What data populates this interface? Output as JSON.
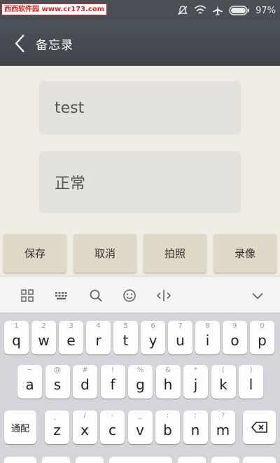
{
  "status_bar": {
    "watermark": "西西软件园 www.cr173.com",
    "battery": "97%",
    "icons": [
      "mute-icon",
      "wifi-icon",
      "airplane-icon",
      "battery-icon"
    ]
  },
  "action_bar": {
    "back_icon": "chevron-left-icon",
    "title": "备忘录"
  },
  "note": {
    "title_value": "test",
    "body_value": "正常"
  },
  "buttons": {
    "save": "保存",
    "cancel": "取消",
    "photo": "拍照",
    "video": "录像"
  },
  "keyboard_toolbar": {
    "icons": [
      "grid-icon",
      "keyboard-icon",
      "search-icon",
      "emoji-icon",
      "cursor-icon",
      "collapse-icon"
    ]
  },
  "keyboard": {
    "row1": [
      {
        "main": "q",
        "sub": "1"
      },
      {
        "main": "w",
        "sub": "2"
      },
      {
        "main": "e",
        "sub": "3"
      },
      {
        "main": "r",
        "sub": "4"
      },
      {
        "main": "t",
        "sub": "5"
      },
      {
        "main": "y",
        "sub": "6"
      },
      {
        "main": "u",
        "sub": "7"
      },
      {
        "main": "i",
        "sub": "8"
      },
      {
        "main": "o",
        "sub": "9"
      },
      {
        "main": "p",
        "sub": "0"
      }
    ],
    "row2": [
      {
        "main": "a",
        "sub": "~"
      },
      {
        "main": "s",
        "sub": "@"
      },
      {
        "main": "d",
        "sub": "#"
      },
      {
        "main": "f",
        "sub": "!"
      },
      {
        "main": "g",
        "sub": "%"
      },
      {
        "main": "h",
        "sub": "&"
      },
      {
        "main": "j",
        "sub": "*"
      },
      {
        "main": "k",
        "sub": "("
      },
      {
        "main": "l",
        "sub": ")"
      }
    ],
    "row3": [
      {
        "main": "z",
        "sub": "、"
      },
      {
        "main": "x",
        "sub": "/"
      },
      {
        "main": "c",
        "sub": "-"
      },
      {
        "main": "v",
        "sub": "_"
      },
      {
        "main": "b",
        "sub": ":"
      },
      {
        "main": "n",
        "sub": ";"
      },
      {
        "main": "m",
        "sub": "?"
      }
    ],
    "shift_label": "通配",
    "backspace_icon": "backspace-icon"
  }
}
